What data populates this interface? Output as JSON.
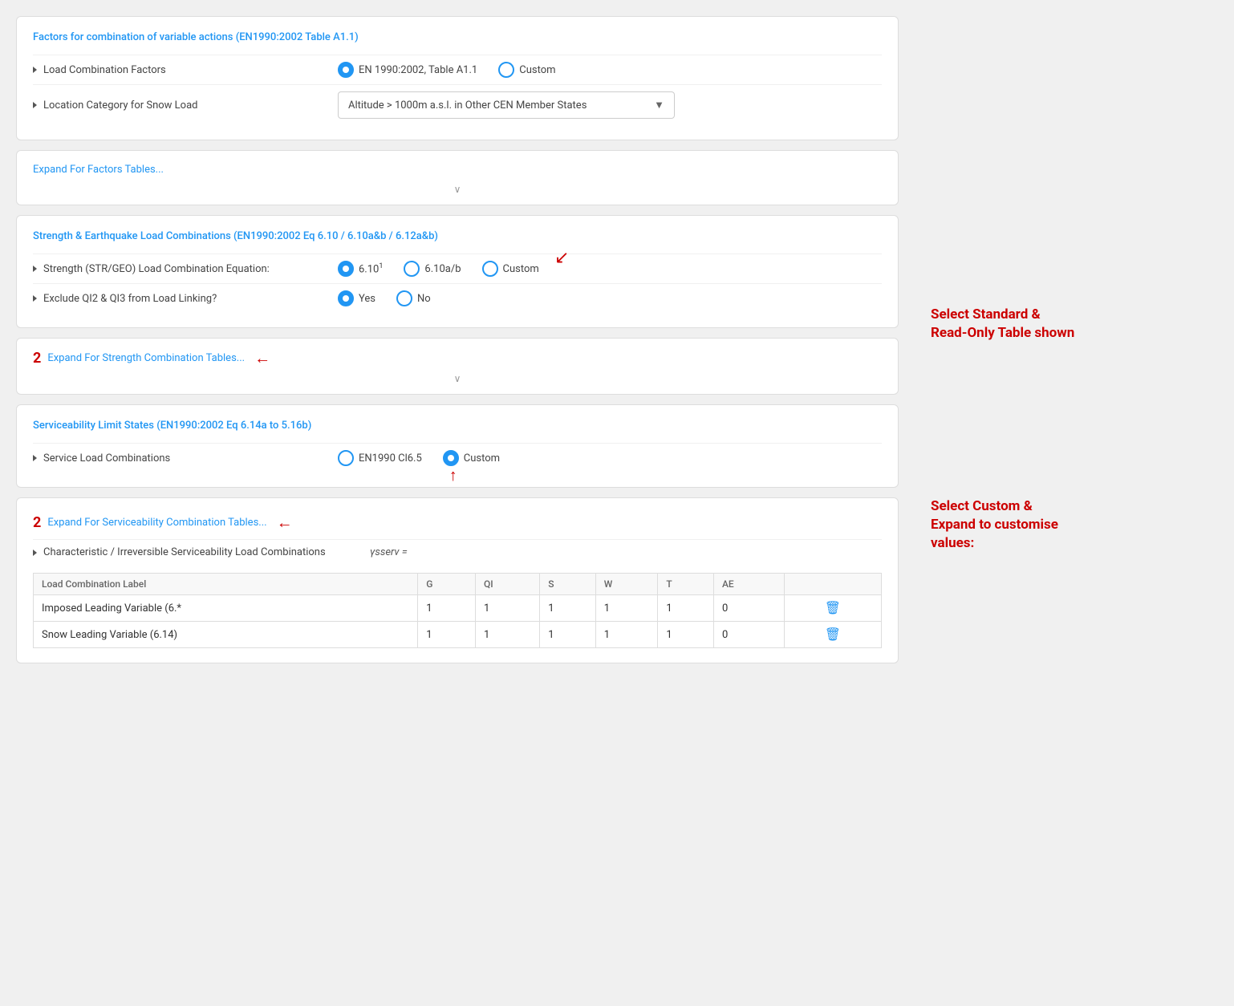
{
  "section1": {
    "title": "Factors for combination of variable actions (EN1990:2002 Table A1.1)",
    "row1": {
      "label": "Load Combination Factors",
      "option1": "EN 1990:2002, Table A1.1",
      "option2": "Custom",
      "option1_selected": true
    },
    "row2": {
      "label": "Location Category for Snow Load",
      "dropdown_value": "Altitude > 1000m a.s.l. in Other CEN Member States"
    }
  },
  "expand1": {
    "link": "Expand For Factors Tables..."
  },
  "section2": {
    "title": "Strength & Earthquake Load Combinations (EN1990:2002 Eq 6.10 / 6.10a&b / 6.12a&b)",
    "row1": {
      "label": "Strength (STR/GEO) Load Combination Equation:",
      "option1": "6.10",
      "option2": "6.10a/b",
      "option3": "Custom",
      "option1_selected": true,
      "superscript": "1"
    },
    "row2": {
      "label": "Exclude QI2 & QI3 from Load Linking?",
      "option1": "Yes",
      "option2": "No",
      "option1_selected": true
    }
  },
  "expand2": {
    "link": "Expand For Strength Combination Tables..."
  },
  "annotation2": {
    "badge": "2",
    "right_text": "Select Standard &\nRead-Only Table shown"
  },
  "section3": {
    "title": "Serviceability Limit States (EN1990:2002 Eq 6.14a to 5.16b)",
    "row1": {
      "label": "Service Load Combinations",
      "option1": "EN1990 Cl6.5",
      "option2": "Custom",
      "option2_selected": true
    }
  },
  "expand3": {
    "link": "Expand For Serviceability Combination Tables..."
  },
  "section4": {
    "title": "Expand For Serviceability Combination Tables...",
    "row1_label": "Characteristic / Irreversible Serviceability Load Combinations",
    "gamma_formula": "γsserv =",
    "table": {
      "headers": [
        "Load Combination Label",
        "G",
        "QI",
        "S",
        "W",
        "T",
        "AE"
      ],
      "rows": [
        [
          "Imposed Leading Variable (6.*",
          "1",
          "1",
          "1",
          "1",
          "1",
          "0"
        ],
        [
          "Snow Leading Variable (6.14)",
          "1",
          "1",
          "1",
          "1",
          "1",
          "0"
        ]
      ]
    }
  },
  "annotation3": {
    "badge": "2",
    "right_text": "Select Custom &\nExpand to customise\nvalues:"
  },
  "annotation_section2_right": "Select Standard &\nRead-Only Table shown",
  "annotation_section3_right": "Select Custom &\nExpand to customise\nvalues:",
  "chevron_char": "∨"
}
